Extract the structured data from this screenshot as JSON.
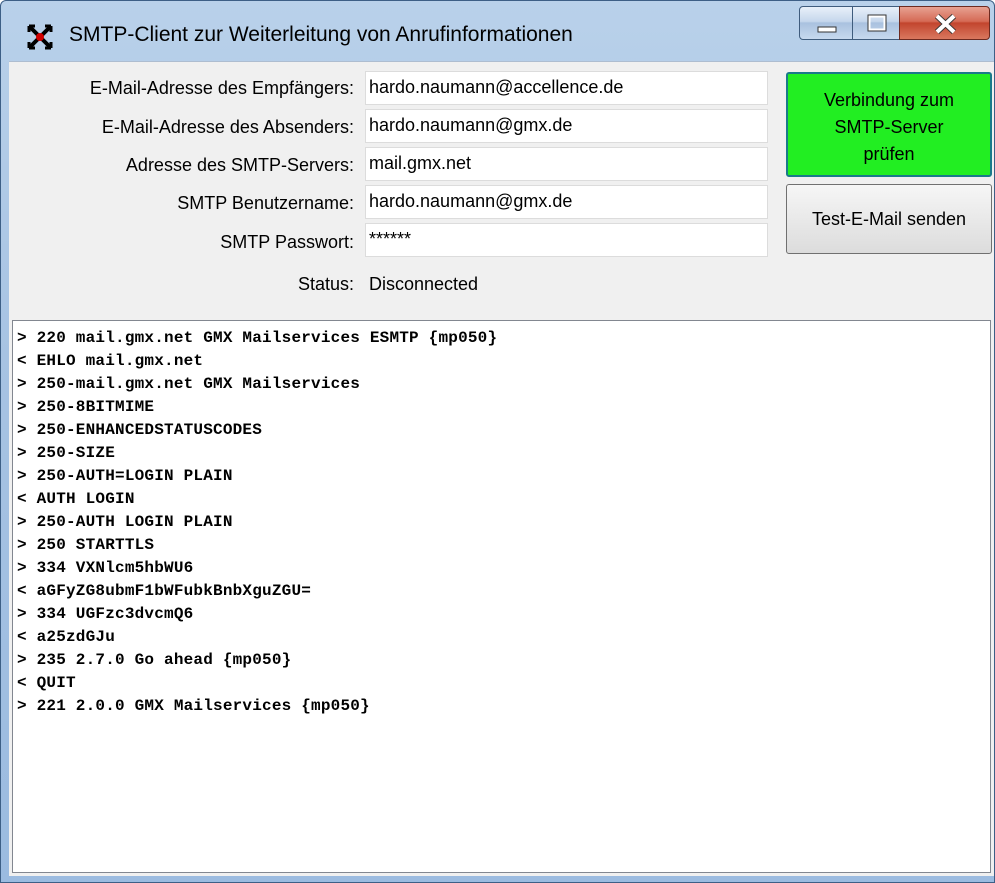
{
  "window": {
    "title": "SMTP-Client zur Weiterleitung von Anrufinformationen",
    "app_icon": "cross-arrows-icon",
    "controls": [
      "minimize-icon",
      "maximize-icon",
      "close-icon"
    ]
  },
  "form": {
    "recipient_label": "E-Mail-Adresse des Empfängers:",
    "recipient_value": "hardo.naumann@accellence.de",
    "sender_label": "E-Mail-Adresse des Absenders:",
    "sender_value": "hardo.naumann@gmx.de",
    "server_label": "Adresse des SMTP-Servers:",
    "server_value": "mail.gmx.net",
    "username_label": "SMTP Benutzername:",
    "username_value": "hardo.naumann@gmx.de",
    "password_label": "SMTP Passwort:",
    "password_value": "******",
    "status_label": "Status:",
    "status_value": "Disconnected"
  },
  "buttons": {
    "verify_line1": "Verbindung zum",
    "verify_line2": "SMTP-Server",
    "verify_line3": "prüfen",
    "test_label": "Test-E-Mail senden"
  },
  "colors": {
    "verify_button": "#22ee22",
    "close_button": "#c2452e"
  },
  "log": [
    "> 220 mail.gmx.net GMX Mailservices ESMTP {mp050}",
    "< EHLO mail.gmx.net",
    "> 250-mail.gmx.net GMX Mailservices",
    "> 250-8BITMIME",
    "> 250-ENHANCEDSTATUSCODES",
    "> 250-SIZE",
    "> 250-AUTH=LOGIN PLAIN",
    "< AUTH LOGIN",
    "> 250-AUTH LOGIN PLAIN",
    "> 250 STARTTLS",
    "> 334 VXNlcm5hbWU6",
    "< aGFyZG8ubmF1bWFubkBnbXguZGU=",
    "> 334 UGFzc3dvcmQ6",
    "< a25zdGJu",
    "> 235 2.7.0 Go ahead {mp050}",
    "< QUIT",
    "> 221 2.0.0 GMX Mailservices {mp050}"
  ]
}
